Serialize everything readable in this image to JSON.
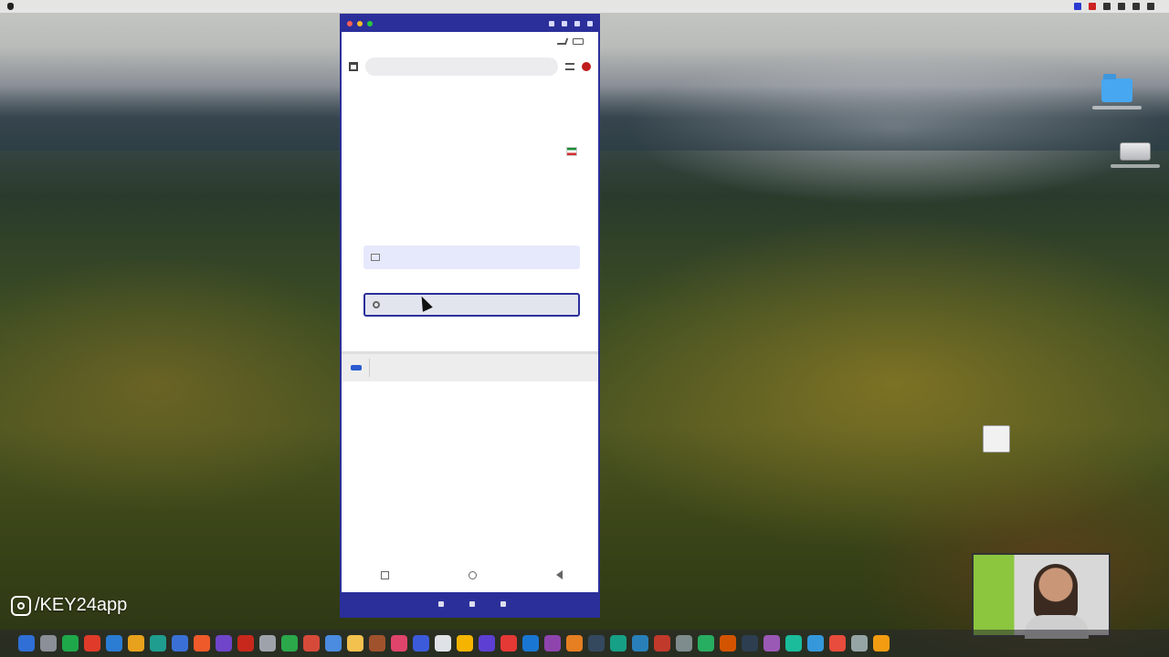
{
  "desktop": {
    "watermark": "/KEY24app"
  },
  "menubar": {
    "items": [
      "",
      "",
      "",
      "",
      ""
    ]
  },
  "phone": {
    "status": {
      "time": "",
      "right": ""
    },
    "browser": {
      "url": ""
    },
    "page": {
      "logo": "",
      "subtitle": "",
      "email_value": "",
      "email_error": "",
      "password_placeholder": "",
      "password_error": "",
      "link_left": "",
      "link_right": ""
    },
    "autofill": {
      "title": "",
      "items": [
        "",
        ""
      ]
    }
  },
  "colors": {
    "accent": "#2b2f9a",
    "error": "#c0392b",
    "brand_red": "#b91c1c",
    "input_bg": "#e6e9fb"
  },
  "dock": {
    "icon_colors": [
      "#2f6fd6",
      "#8a8f98",
      "#1ea84a",
      "#e03b2a",
      "#2b7cd3",
      "#e8a11c",
      "#1f9e8f",
      "#3a70d6",
      "#ef5a2a",
      "#6f45c9",
      "#c8281c",
      "#9ea3ab",
      "#2aa84a",
      "#d64a3a",
      "#4b8be0",
      "#f2c14e",
      "#a0522d",
      "#e0446a",
      "#3b5bdb",
      "#dfe3e8",
      "#f4b400",
      "#5d3fd3",
      "#e53935",
      "#1976d2",
      "#8e44ad",
      "#e67e22",
      "#34495e",
      "#16a085",
      "#2980b9",
      "#c0392b",
      "#7f8c8d",
      "#27ae60",
      "#d35400",
      "#2c3e50",
      "#9b59b6",
      "#1abc9c",
      "#3498db",
      "#e74c3c",
      "#95a5a6",
      "#f39c12"
    ]
  }
}
